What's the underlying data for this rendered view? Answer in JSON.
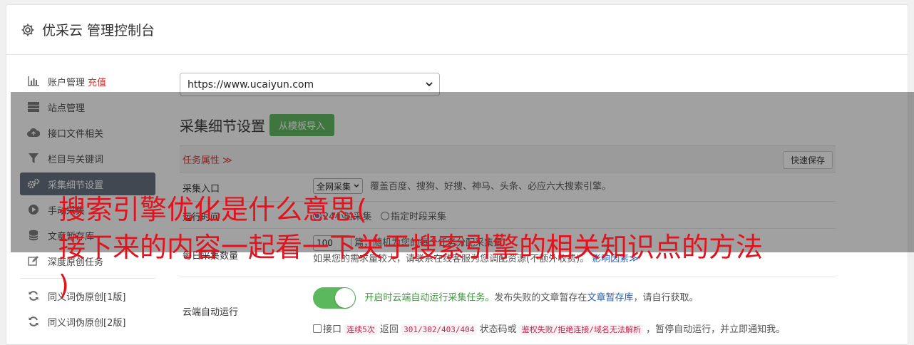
{
  "header": {
    "title": "优采云 管理控制台",
    "icon": "gear-icon"
  },
  "sidebar": {
    "items": [
      {
        "label": "账户管理",
        "badge": "充值",
        "icon": "bar-chart-icon"
      },
      {
        "label": "站点管理",
        "icon": "server-icon"
      },
      {
        "label": "接口文件相关",
        "icon": "cloud-upload-icon"
      },
      {
        "label": "栏目与关键词",
        "icon": "filter-icon"
      },
      {
        "label": "采集细节设置",
        "icon": "cogs-icon",
        "active": true
      },
      {
        "label": "手动采集",
        "icon": "play-circle-icon"
      },
      {
        "label": "文章暂存库",
        "icon": "database-icon"
      },
      {
        "label": "深度原创任务",
        "icon": "edit-icon"
      },
      {
        "label": "同义词伪原创[1版]",
        "icon": "refresh-icon"
      },
      {
        "label": "同义词伪原创[2版]",
        "icon": "refresh-icon"
      }
    ]
  },
  "main": {
    "site_select": "https://www.ucaiyun.com",
    "section_title": "采集细节设置",
    "import_button": "从模板导入",
    "task_attr": "任务属性 ≫",
    "quick_save": "快速保存",
    "rows": {
      "entry": {
        "label": "采集入口",
        "select": "全网采集",
        "desc": "覆盖百度、搜狗、好搜、神马、头条、必应六大搜索引擎。"
      },
      "time": {
        "label": "运行时间",
        "opt1": "24小时采集",
        "opt2": "指定时段采集"
      },
      "count": {
        "label": "每日采集数量",
        "value": "100",
        "desc_a": "篇，随机为您的每个任务分配采集量",
        "desc_b": "如果您的需求量较大，请联系在线客服为您调配资源(不额外收费)。",
        "link": "影响因素≫"
      },
      "cloud": {
        "label": "云端自动运行",
        "on_text": "开启时云端自动运行采集任务。",
        "desc_a": "发布失败的文章暂存在",
        "link": "文章暂存库",
        "desc_b": "，请自行获取。",
        "check_a": "接口",
        "code1": "连续5次",
        "text1": "返回",
        "code2": "301/302/403/404",
        "text2": "状态码或",
        "code3": "鉴权失败/拒绝连接/域名无法解析",
        "text3": "，暂停自动运行，并立即通知我。"
      }
    }
  },
  "watermark": {
    "line1": "搜索引擎优化是什么意思(",
    "line2": "接下来的内容一起看一下关于搜索引擎的相关知识点的方法",
    "line3": ")"
  },
  "colors": {
    "accent_green": "#5cb85c",
    "danger": "#d9322f",
    "sidebar_active": "#5f6b7a",
    "headline": "#e0141e"
  }
}
